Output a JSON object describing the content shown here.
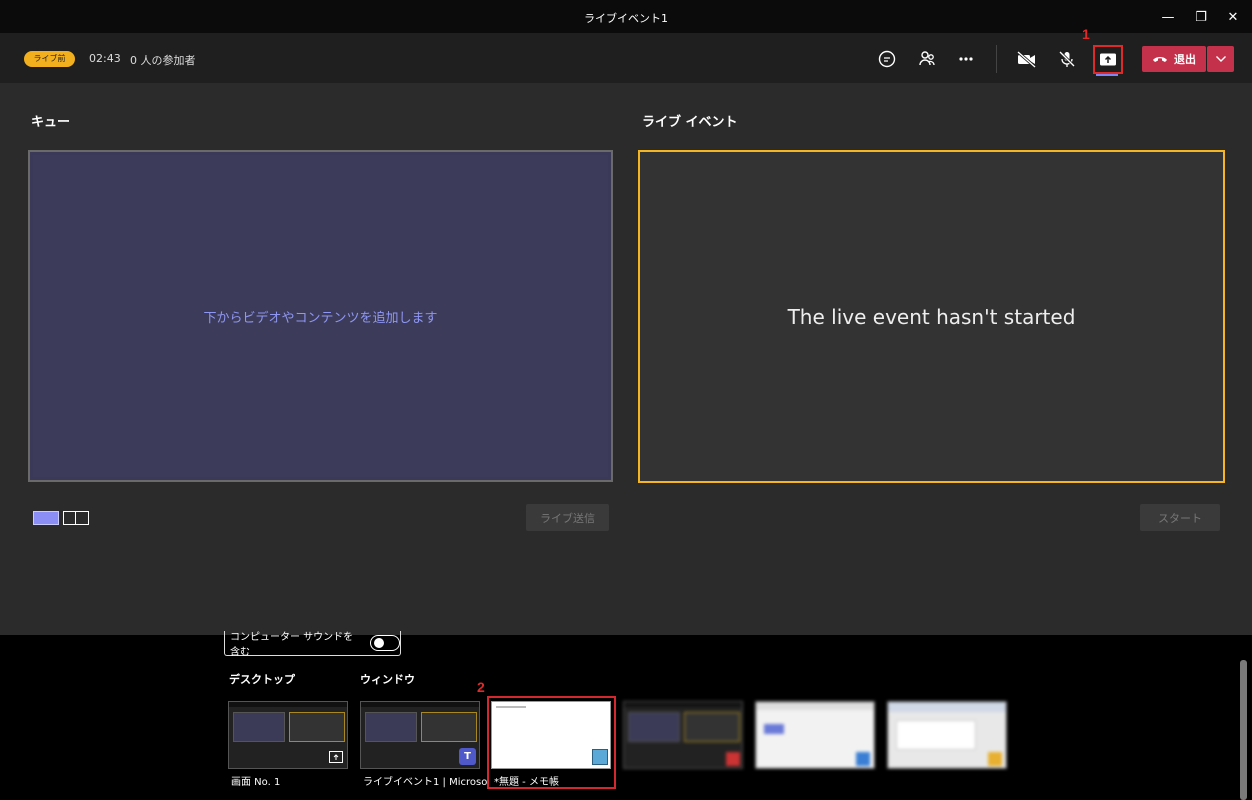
{
  "window": {
    "title": "ライブイベント1",
    "minimize": "—",
    "restore": "❐",
    "close": "✕"
  },
  "toolbar": {
    "status_badge": "ライブ前",
    "timer": "02:43",
    "participants": "0 人の参加者",
    "leave_label": "退出",
    "icons": [
      "chat-icon",
      "people-icon",
      "more-icon",
      "camera-off-icon",
      "mic-off-icon",
      "share-icon",
      "hangup-icon",
      "chevron-down-icon"
    ]
  },
  "annotations": {
    "one": "1",
    "two": "2"
  },
  "queue": {
    "title": "キュー",
    "placeholder": "下からビデオやコンテンツを追加します",
    "send_button": "ライブ送信"
  },
  "live": {
    "title": "ライブ イベント",
    "status": "The live event hasn't started",
    "start_button": "スタート"
  },
  "tray": {
    "sound_label": "コンピューター サウンドを含む",
    "desktop_label": "デスクトップ",
    "window_label": "ウィンドウ",
    "items": [
      {
        "caption": "画面 No. 1"
      },
      {
        "caption": "ライブイベント1 | Microsoft ..."
      },
      {
        "caption": "*無題 - メモ帳"
      },
      {
        "caption": ""
      },
      {
        "caption": ""
      },
      {
        "caption": ""
      }
    ]
  },
  "colors": {
    "accent_purple": "#8b8ff5",
    "highlight_red": "#e02a2a",
    "leave_red": "#c4314b",
    "live_border": "#f5b622",
    "badge_yellow": "#f2b01e"
  }
}
